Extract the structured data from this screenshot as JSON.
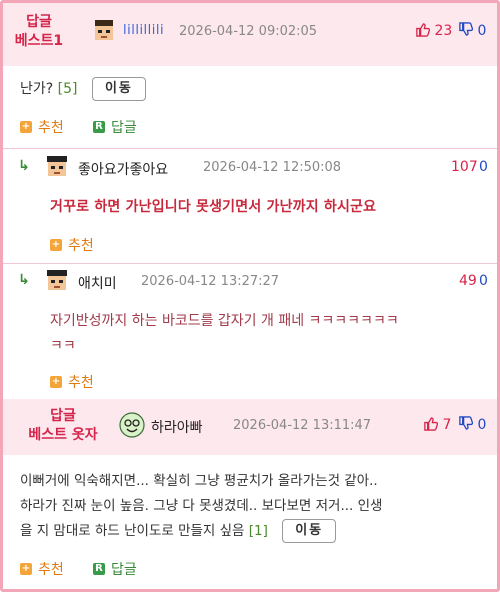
{
  "comments": [
    {
      "badge": [
        "답글",
        "베스트1"
      ],
      "avatar": "pixel-face-icon",
      "nickname": "lillillili",
      "date": "2026-04-12 09:02:05",
      "up": "23",
      "down": "0",
      "text": "난가?",
      "count": "[5]",
      "move_label": "이동",
      "actions": {
        "recommend": "추천",
        "reply": "답글"
      },
      "replies": [
        {
          "avatar": "pixel-face-icon",
          "nickname": "좋아요가좋아요",
          "date": "2026-04-12 12:50:08",
          "up": "107",
          "down": "0",
          "text": "거꾸로 하면 가난입니다 못생기면서 가난까지 하시군요",
          "recommend": "추천"
        },
        {
          "avatar": "pixel-face-icon",
          "nickname": "애치미",
          "date": "2026-04-12 13:27:27",
          "up": "49",
          "down": "0",
          "text_line1": "자기반성까지 하는 바코드를 갑자기 개 패네 ㅋㅋㅋㅋㅋㅋㅋ",
          "text_line2": "ㅋㅋ",
          "recommend": "추천"
        }
      ]
    },
    {
      "badge": [
        "답글",
        "베스트 옷자"
      ],
      "avatar": "smiling-face-icon",
      "nickname": "하라아빠",
      "date": "2026-04-12 13:11:47",
      "up": "7",
      "down": "0",
      "text_line1": "이뻐거에 익숙해지면... 확실히 그냥 평균치가 올라가는것 같아..",
      "text_line2": "하라가 진짜 눈이 높음. 그냥 다 못생겼데.. 보다보면 저거... 인생",
      "text_line3": "을 지 맘대로 하드 난이도로 만들지 싶음",
      "count": "[1]",
      "move_label": "이동",
      "actions": {
        "recommend": "추천",
        "reply": "답글"
      }
    }
  ],
  "colors": {
    "accent_red": "#d6234a",
    "vote_down_blue": "#2149c4",
    "frame_pink": "#f2a6b8"
  }
}
